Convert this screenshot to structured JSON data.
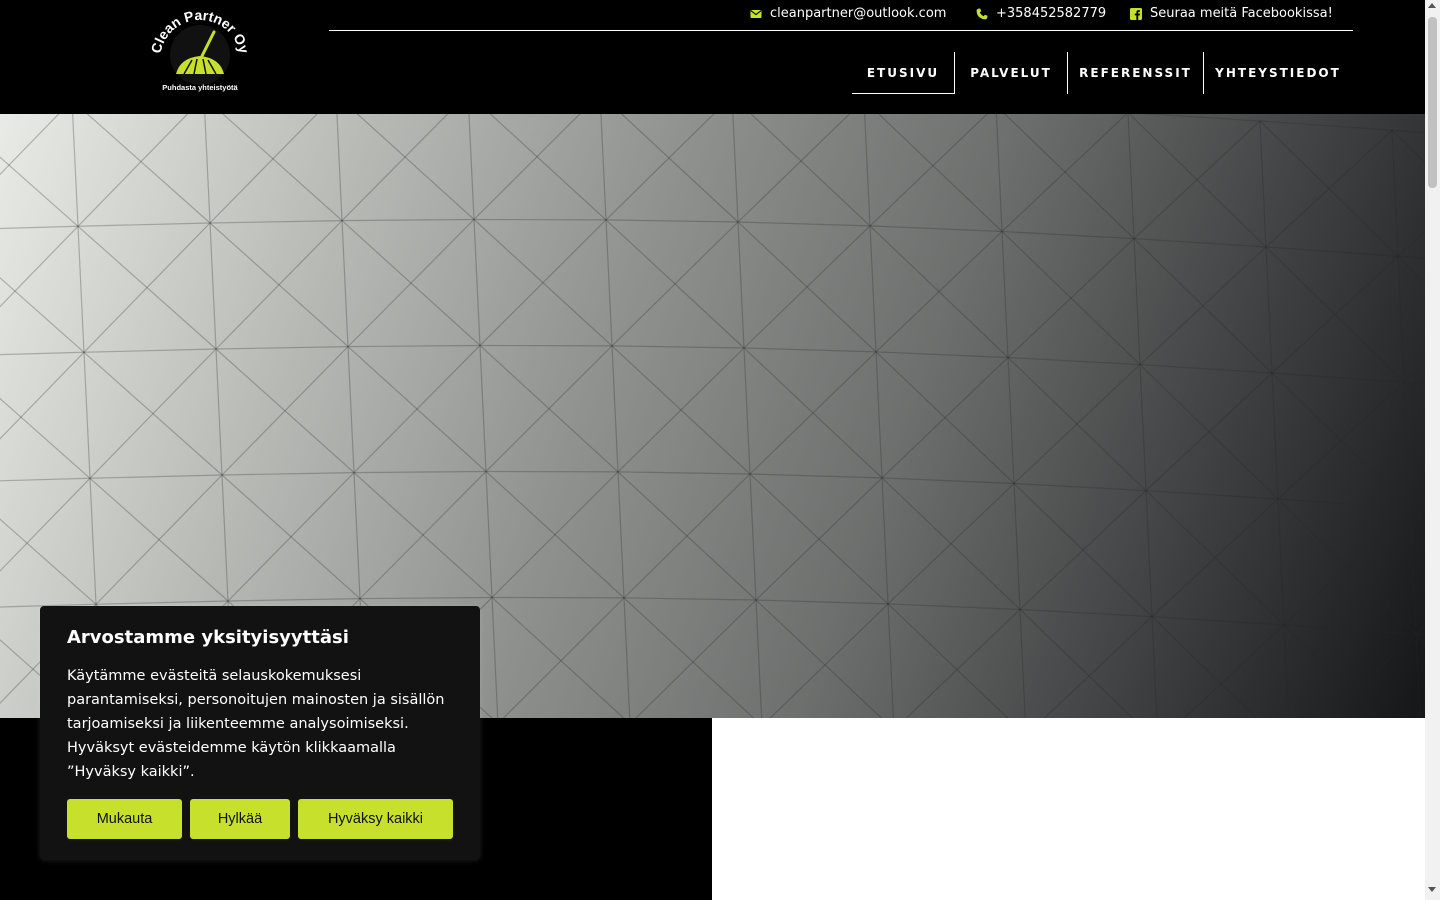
{
  "brand": {
    "name": "Clean Partner Oy",
    "tagline": "Puhdasta yhteistyötä",
    "accent": "#c7e02b"
  },
  "topbar": {
    "email": "cleanpartner@outlook.com",
    "phone": "+358452582779",
    "facebook": "Seuraa meitä Facebookissa!"
  },
  "nav": {
    "items": [
      {
        "label": "ETUSIVU",
        "active": true
      },
      {
        "label": "PALVELUT",
        "active": false
      },
      {
        "label": "REFERENSSIT",
        "active": false
      },
      {
        "label": "YHTEYSTIEDOT",
        "active": false
      }
    ]
  },
  "cookie": {
    "title": "Arvostamme yksityisyyttäsi",
    "text": "Käytämme evästeitä selauskokemuksesi parantamiseksi, personoitujen mainosten ja sisällön tarjoamiseksi ja liikenteemme analysoimiseksi. Hyväksyt evästeidemme käytön klikkaamalla ”Hyväksy kaikki”.",
    "customize": "Mukauta",
    "reject": "Hylkää",
    "accept_all": "Hyväksy kaikki"
  },
  "icons": {
    "mail": "envelope-icon",
    "phone": "phone-icon",
    "facebook": "facebook-icon"
  }
}
